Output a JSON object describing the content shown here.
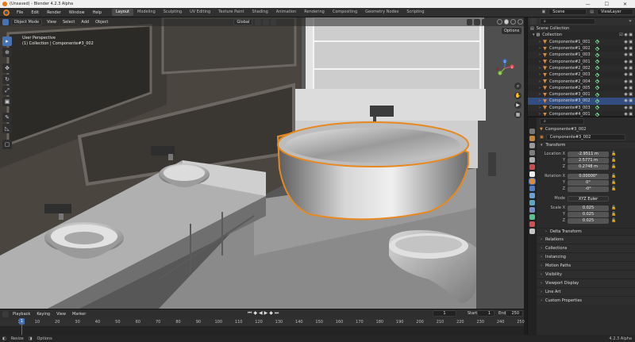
{
  "window": {
    "title": "(Unsaved) - Blender 4.2.3 Alpha",
    "controls": [
      "—",
      "☐",
      "✕"
    ]
  },
  "menu": [
    "File",
    "Edit",
    "Render",
    "Window",
    "Help"
  ],
  "workspaces": [
    "Layout",
    "Modeling",
    "Sculpting",
    "UV Editing",
    "Texture Paint",
    "Shading",
    "Animation",
    "Rendering",
    "Compositing",
    "Geometry Nodes",
    "Scripting"
  ],
  "active_workspace": "Layout",
  "top_right": {
    "scene": "Scene",
    "view_layer": "ViewLayer"
  },
  "viewport_header": {
    "mode": "Object Mode",
    "view": "View",
    "select": "Select",
    "add": "Add",
    "object": "Object",
    "orientation": "Global",
    "options": "Options"
  },
  "viewport_info": {
    "line1": "User Perspective",
    "line2": "(1) Collection | Componente#3_002"
  },
  "gizmo": {
    "x": "X",
    "y": "Y",
    "z": "Z"
  },
  "toolbar_icons": [
    "cursor-select-icon",
    "cursor-icon",
    "move-icon",
    "rotate-icon",
    "scale-icon",
    "transform-icon",
    "annotate-icon",
    "measure-icon",
    "add-cube-icon"
  ],
  "outliner": {
    "root": "Scene Collection",
    "collection": "Collection",
    "items": [
      "Componente#1_001",
      "Componente#1_002",
      "Componente#1_003",
      "Componente#2_001",
      "Componente#2_002",
      "Componente#2_003",
      "Componente#2_004",
      "Componente#2_005",
      "Componente#3_001",
      "Componente#3_002",
      "Componente#3_003",
      "Componente#4_001",
      "Componente#4_002"
    ],
    "selected_index": 9
  },
  "properties": {
    "search_placeholder": "",
    "object_name_header": "Componente#3_002",
    "object_name": "Componente#3_002",
    "transform_title": "Transform",
    "location": {
      "label_x": "Location X",
      "x": "-2.9511 m",
      "y": "2.5771 m",
      "z": "0.2748 m"
    },
    "rotation": {
      "label_x": "Rotation X",
      "x": "0.00000°",
      "y": "0°",
      "z": "-0°"
    },
    "mode": {
      "label": "Mode",
      "value": "XYZ Euler"
    },
    "scale": {
      "label_x": "Scale X",
      "x": "0.025",
      "y": "0.025",
      "z": "0.025"
    },
    "y_label": "Y",
    "z_label": "Z",
    "delta_transform": "Delta Transform",
    "panels": [
      "Relations",
      "Collections",
      "Instancing",
      "Motion Paths",
      "Visibility",
      "Viewport Display",
      "Line Art",
      "Custom Properties"
    ]
  },
  "timeline": {
    "playback": "Playback",
    "keying": "Keying",
    "view": "View",
    "marker": "Marker",
    "current_frame": "1",
    "start_label": "Start",
    "start": "1",
    "end_label": "End",
    "end": "250",
    "ticks": [
      "1",
      "10",
      "20",
      "30",
      "40",
      "50",
      "60",
      "70",
      "80",
      "90",
      "100",
      "110",
      "120",
      "130",
      "140",
      "150",
      "160",
      "170",
      "180",
      "190",
      "200",
      "210",
      "220",
      "230",
      "240",
      "250"
    ],
    "playhead": "1"
  },
  "status": {
    "left1": "Resize",
    "left2": "Options",
    "version": "4.2.3 Alpha"
  },
  "colors": {
    "accent": "#4772b3",
    "selection_outline": "#e8891f",
    "mesh_orange": "#e08b3a"
  }
}
